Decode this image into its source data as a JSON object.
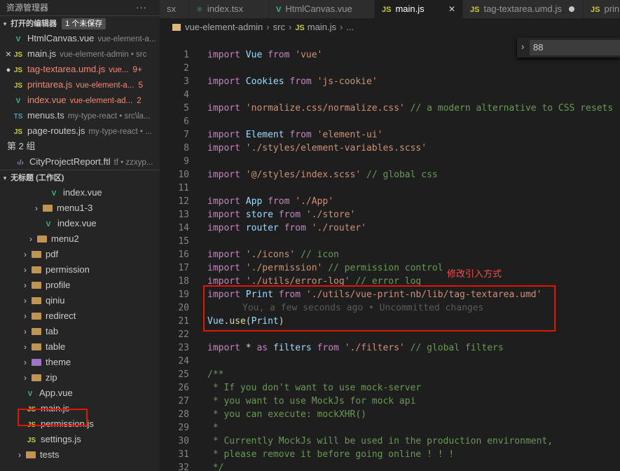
{
  "sidebar": {
    "title": "资源管理器",
    "more": "···",
    "open_editors": {
      "label": "打开的编辑器",
      "badge": "1 个未保存"
    },
    "open_files": [
      {
        "lead": "",
        "icon": "V",
        "type": "vue",
        "name": "HtmlCanvas.vue",
        "sub": "vue-element-a...",
        "count": "",
        "err": false
      },
      {
        "lead": "✕",
        "icon": "JS",
        "type": "js",
        "name": "main.js",
        "sub": "vue-element-admin • src",
        "count": "",
        "err": false
      },
      {
        "lead": "●",
        "icon": "JS",
        "type": "js",
        "name": "tag-textarea.umd.js",
        "sub": "vue...",
        "count": "9+",
        "err": true
      },
      {
        "lead": "",
        "icon": "JS",
        "type": "js",
        "name": "printarea.js",
        "sub": "vue-element-a...",
        "count": "5",
        "err": true
      },
      {
        "lead": "",
        "icon": "V",
        "type": "vue",
        "name": "index.vue",
        "sub": "vue-element-ad...",
        "count": "2",
        "err": true
      },
      {
        "lead": "",
        "icon": "TS",
        "type": "ts",
        "name": "menus.ts",
        "sub": "my-type-react • src\\la...",
        "count": "",
        "err": false
      },
      {
        "lead": "",
        "icon": "JS",
        "type": "js",
        "name": "page-routes.js",
        "sub": "my-type-react • ...",
        "count": "",
        "err": false
      }
    ],
    "group2": "第 2 组",
    "group2_file": {
      "icon": "‹/›",
      "name": "CityProjectReport.ftl",
      "sub": "tf • zzxyp..."
    },
    "workspace": "无标题 (工作区)",
    "tree": [
      {
        "kind": "vue",
        "name": "index.vue"
      },
      {
        "kind": "folder",
        "name": "menu1-3"
      },
      {
        "kind": "vue",
        "name": "index.vue"
      },
      {
        "kind": "folder",
        "name": "menu2"
      },
      {
        "kind": "folder",
        "name": "pdf"
      },
      {
        "kind": "folder",
        "name": "permission"
      },
      {
        "kind": "folder",
        "name": "profile"
      },
      {
        "kind": "folder",
        "name": "qiniu"
      },
      {
        "kind": "folder",
        "name": "redirect"
      },
      {
        "kind": "folder",
        "name": "tab"
      },
      {
        "kind": "folder",
        "name": "table"
      },
      {
        "kind": "folder",
        "name": "theme"
      },
      {
        "kind": "folder",
        "name": "zip"
      },
      {
        "kind": "vue",
        "name": "App.vue"
      },
      {
        "kind": "js",
        "name": "main.js"
      },
      {
        "kind": "js",
        "name": "permission.js"
      },
      {
        "kind": "js",
        "name": "settings.js"
      },
      {
        "kind": "folder",
        "name": "tests"
      }
    ]
  },
  "tabs": [
    {
      "name": "sx",
      "icon": ""
    },
    {
      "name": "index.tsx",
      "icon": "⚛"
    },
    {
      "name": "HtmlCanvas.vue",
      "icon": "V"
    },
    {
      "name": "main.js",
      "icon": "JS"
    },
    {
      "name": "tag-textarea.umd.js",
      "icon": "JS"
    },
    {
      "name": "prin",
      "icon": "JS"
    }
  ],
  "breadcrumb": [
    "vue-element-admin",
    "src",
    "main.js",
    "..."
  ],
  "find": {
    "value": "88"
  },
  "annotation": "修改引入方式",
  "blame": "You, a few seconds ago • Uncommitted changes",
  "colors": {
    "annotation": "#f14c4c",
    "highlight_box": "#e51400"
  },
  "code_lines": [
    "import Vue from 'vue'",
    "",
    "import Cookies from 'js-cookie'",
    "",
    "import 'normalize.css/normalize.css' // a modern alternative to CSS resets",
    "",
    "import Element from 'element-ui'",
    "import './styles/element-variables.scss'",
    "",
    "import '@/styles/index.scss' // global css",
    "",
    "import App from './App'",
    "import store from './store'",
    "import router from './router'",
    "",
    "import './icons' // icon",
    "import './permission' // permission control",
    "import './utils/error-log' // error log",
    "import Print from './utils/vue-print-nb/lib/tag-textarea.umd'",
    "",
    "Vue.use(Print)",
    "",
    "import * as filters from './filters' // global filters",
    "",
    "/**",
    " * If you don't want to use mock-server",
    " * you want to use MockJs for mock api",
    " * you can execute: mockXHR()",
    " *",
    " * Currently MockJs will be used in the production environment,",
    " * please remove it before going online ! ! !",
    " */"
  ]
}
